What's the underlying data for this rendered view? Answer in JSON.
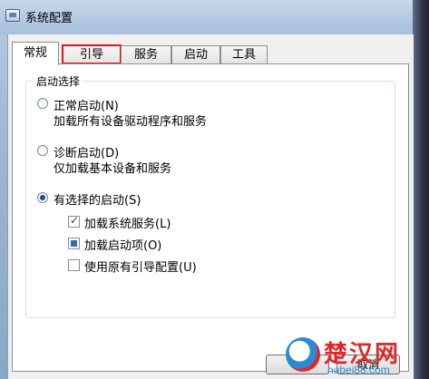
{
  "window": {
    "title": "系统配置"
  },
  "tabs": [
    {
      "label": "常规",
      "active": true
    },
    {
      "label": "引导",
      "highlighted": true
    },
    {
      "label": "服务"
    },
    {
      "label": "启动"
    },
    {
      "label": "工具"
    }
  ],
  "startup": {
    "legend": "启动选择",
    "options": [
      {
        "label": "正常启动(N)",
        "desc": "加载所有设备驱动程序和服务",
        "selected": false
      },
      {
        "label": "诊断启动(D)",
        "desc": "仅加载基本设备和服务",
        "selected": false
      },
      {
        "label": "有选择的启动(S)",
        "selected": true
      }
    ],
    "checks": [
      {
        "label": "加载系统服务(L)",
        "state": "checked"
      },
      {
        "label": "加载启动项(O)",
        "state": "indeterminate"
      },
      {
        "label": "使用原有引导配置(U)",
        "state": "unchecked"
      }
    ]
  },
  "buttons": {
    "ok_partial": "",
    "cancel_partial": "取消"
  },
  "watermark": {
    "name": "楚汉网",
    "url": "hubei88.com"
  }
}
